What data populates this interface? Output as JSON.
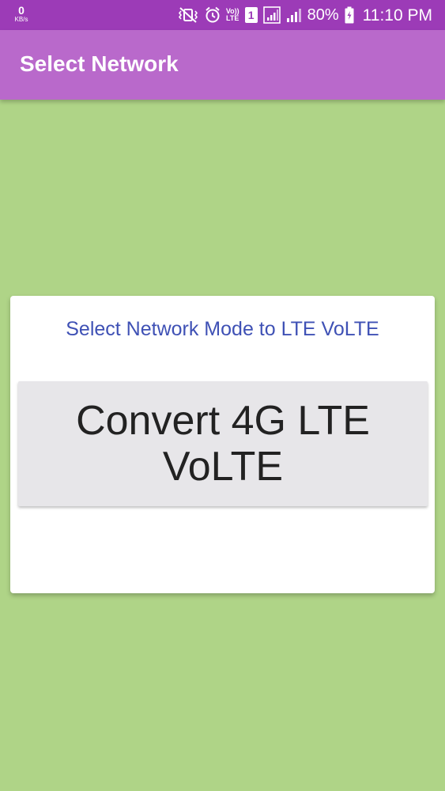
{
  "status_bar": {
    "net_speed_value": "0",
    "net_speed_unit": "KB/s",
    "sim_slot": "1",
    "volte_top": "Vo))",
    "volte_bottom": "LTE",
    "battery": "80%",
    "time": "11:10 PM",
    "icons": [
      "vibrate-mute-icon",
      "alarm-icon",
      "volte-icon",
      "sim-1-icon",
      "signal-sim1-icon",
      "signal-sim2-icon",
      "battery-charging-icon"
    ]
  },
  "app_bar": {
    "title": "Select Network"
  },
  "card": {
    "subtitle": "Select Network Mode to LTE VoLTE",
    "button_label": "Convert 4G LTE VoLTE"
  },
  "colors": {
    "status_bar": "#9c3bb7",
    "app_bar": "#b969cb",
    "background": "#afd487",
    "subtitle_text": "#3f51b5",
    "button_bg": "#e7e6e9"
  }
}
